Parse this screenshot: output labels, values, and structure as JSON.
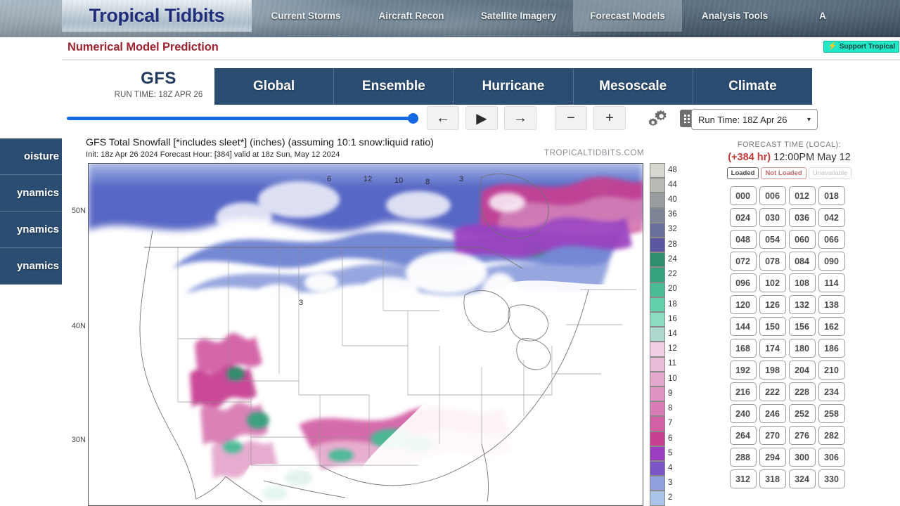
{
  "site": {
    "logo_text": "Tropical Tidbits",
    "nav_items": [
      {
        "label": "Current Storms",
        "active": false
      },
      {
        "label": "Aircraft Recon",
        "active": false
      },
      {
        "label": "Satellite Imagery",
        "active": false
      },
      {
        "label": "Forecast Models",
        "active": true
      },
      {
        "label": "Analysis Tools",
        "active": false
      },
      {
        "label": "A",
        "active": false
      }
    ]
  },
  "subheader": {
    "page_title": "Numerical Model Prediction",
    "support_label": "Support Tropical",
    "bolt_icon": "lightning-bolt-icon"
  },
  "model": {
    "name": "GFS",
    "run_time_caption": "RUN TIME: 18Z APR 26",
    "tabs": [
      {
        "label": "Global"
      },
      {
        "label": "Ensemble"
      },
      {
        "label": "Hurricane"
      },
      {
        "label": "Mesoscale"
      },
      {
        "label": "Climate"
      }
    ]
  },
  "controls": {
    "prev_label": "←",
    "play_label": "▶",
    "next_label": "→",
    "minus_label": "−",
    "plus_label": "+",
    "settings_icon": "gears-icon",
    "keyboard_icon": "keyboard-icon",
    "run_time_selected": "Run Time: 18Z Apr 26",
    "caret_icon": "chevron-down-icon",
    "slider_value": 100
  },
  "sidebar": {
    "items": [
      {
        "label": "oisture"
      },
      {
        "label": "ynamics"
      },
      {
        "label": "ynamics"
      },
      {
        "label": "ynamics"
      }
    ]
  },
  "map": {
    "title": "GFS Total Snowfall [*includes sleet*] (inches) (assuming 10:1  snow:liquid ratio)",
    "subtitle": "Init: 18z Apr 26 2024   Forecast Hour: [384]   valid at 18z Sun, May 12 2024",
    "watermark": "TROPICALTIDBITS.COM",
    "lat_labels": [
      "50N",
      "40N",
      "30N"
    ]
  },
  "chart_data": {
    "type": "heatmap",
    "title": "GFS Total Snowfall [*includes sleet*] (inches) (assuming 10:1  snow:liquid ratio)",
    "subtitle": "Init: 18z Apr 26 2024   Forecast Hour: [384]   valid at 18z Sun, May 12 2024",
    "units": "inches",
    "variable": "Total Snowfall",
    "model": "GFS",
    "forecast_hour": 384,
    "valid_time": "18z Sun, May 12 2024",
    "init_time": "18z Apr 26 2024",
    "region": "North America",
    "ylabel": "Latitude",
    "ytick_labels": [
      "50N",
      "40N",
      "30N"
    ],
    "colorbar": {
      "position": "right",
      "ticks": [
        48,
        44,
        40,
        36,
        32,
        28,
        24,
        22,
        20,
        18,
        16,
        14,
        12,
        11,
        10,
        9,
        8,
        7,
        6,
        5,
        4,
        3,
        2
      ],
      "colors": [
        "#d8d8d0",
        "#b9bbb4",
        "#9a9da0",
        "#7e8396",
        "#6b6f9b",
        "#5a56a0",
        "#2f8f6d",
        "#34a37d",
        "#49bb95",
        "#64cfac",
        "#8adcc2",
        "#add8cf",
        "#f0cfe2",
        "#eabcd8",
        "#e5a8cd",
        "#df93c2",
        "#d97bb4",
        "#d35fa4",
        "#c73f93",
        "#9b3fc0",
        "#7b55c4",
        "#8fa0dd",
        "#a9c3e6"
      ]
    },
    "inline_labels": [
      {
        "value": 6,
        "x": 0.43,
        "y": 0.04
      },
      {
        "value": 12,
        "x": 0.5,
        "y": 0.04
      },
      {
        "value": 10,
        "x": 0.555,
        "y": 0.045
      },
      {
        "value": 8,
        "x": 0.61,
        "y": 0.05
      },
      {
        "value": 3,
        "x": 0.67,
        "y": 0.045
      },
      {
        "value": 3,
        "x": 0.385,
        "y": 0.41
      }
    ]
  },
  "right_panel": {
    "forecast_time_label": "FORECAST TIME (LOCAL):",
    "forecast_hour_text": "(+384 hr)",
    "forecast_time_text": "12:00PM May 12",
    "status_legend": [
      {
        "label": "Loaded",
        "state": "loaded"
      },
      {
        "label": "Not Loaded",
        "state": "not-loaded"
      },
      {
        "label": "Unavailable",
        "state": "unavailable"
      }
    ],
    "hours": [
      "000",
      "006",
      "012",
      "018",
      "024",
      "030",
      "036",
      "042",
      "048",
      "054",
      "060",
      "066",
      "072",
      "078",
      "084",
      "090",
      "096",
      "102",
      "108",
      "114",
      "120",
      "126",
      "132",
      "138",
      "144",
      "150",
      "156",
      "162",
      "168",
      "174",
      "180",
      "186",
      "192",
      "198",
      "204",
      "210",
      "216",
      "222",
      "228",
      "234",
      "240",
      "246",
      "252",
      "258",
      "264",
      "270",
      "276",
      "282",
      "288",
      "294",
      "300",
      "306",
      "312",
      "318",
      "324",
      "330"
    ]
  }
}
